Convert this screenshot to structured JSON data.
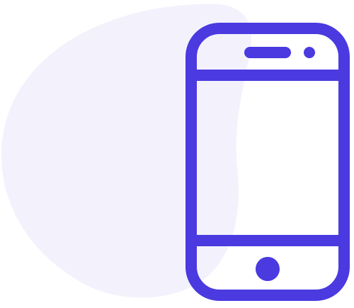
{
  "illustration": {
    "subject": "smartphone-icon",
    "colors": {
      "stroke": "#4A3AE0",
      "blob": "#F3F2FC",
      "background": "#FFFFFF"
    }
  }
}
